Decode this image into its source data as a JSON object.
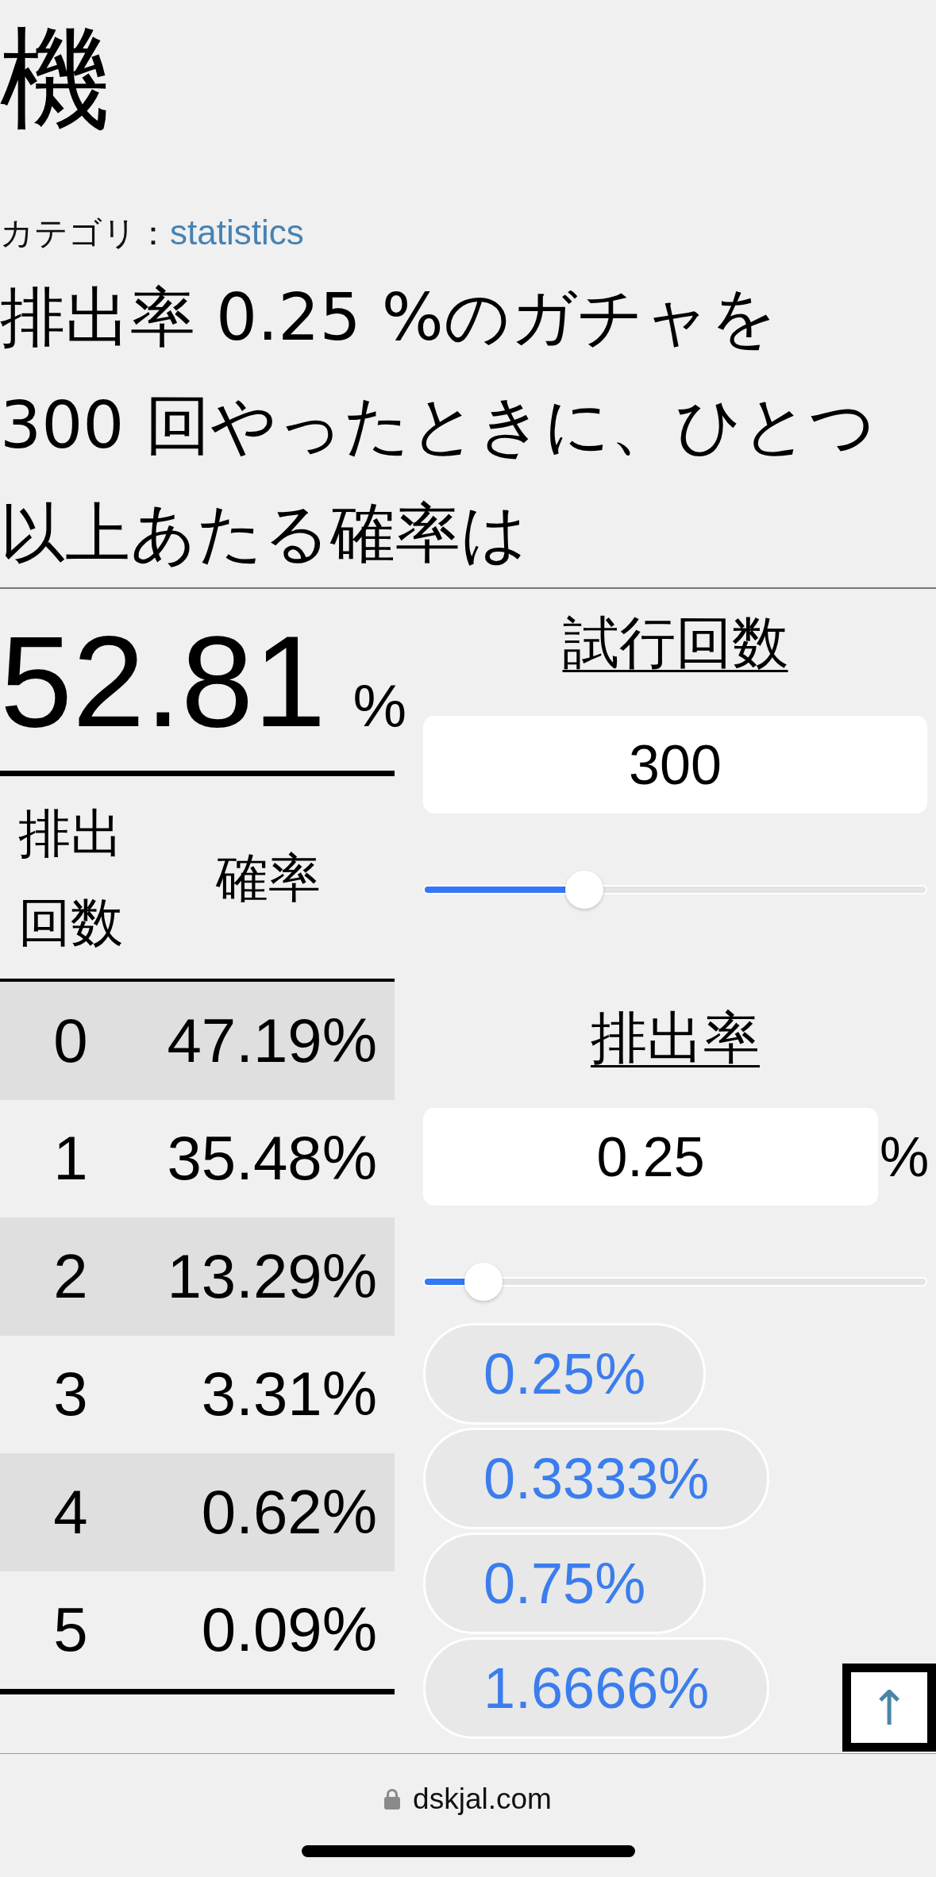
{
  "page": {
    "title": "機",
    "category": {
      "label": "カテゴリ：",
      "link": "statistics"
    },
    "question": "排出率 0.25 %のガチャを300 回やったときに、ひとつ以上あたる確率は"
  },
  "result": {
    "value": "52.81",
    "unit": "%"
  },
  "table": {
    "columns": [
      "排出回数",
      "確率"
    ],
    "rows": [
      {
        "count": "0",
        "probability": "47.19%"
      },
      {
        "count": "1",
        "probability": "35.48%"
      },
      {
        "count": "2",
        "probability": "13.29%"
      },
      {
        "count": "3",
        "probability": "3.31%"
      },
      {
        "count": "4",
        "probability": "0.62%"
      },
      {
        "count": "5",
        "probability": "0.09%"
      }
    ]
  },
  "controls": [
    {
      "label": "試行回数",
      "value": "300",
      "level": 0.32
    },
    {
      "label": "排出率",
      "value": "0.25",
      "unit": "%",
      "level": 0.12
    }
  ],
  "presets": [
    "0.25%",
    "0.3333%",
    "0.75%",
    "1.6666%"
  ],
  "scroll_top_button": {
    "label": "↑"
  },
  "browser_bar": {
    "url": "dskjal.com"
  }
}
